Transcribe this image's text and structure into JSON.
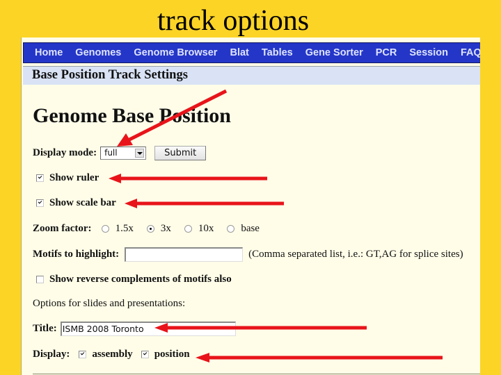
{
  "slide": {
    "title": "track options"
  },
  "navbar": {
    "items": [
      {
        "label": "Home"
      },
      {
        "label": "Genomes"
      },
      {
        "label": "Genome Browser"
      },
      {
        "label": "Blat"
      },
      {
        "label": "Tables"
      },
      {
        "label": "Gene Sorter"
      },
      {
        "label": "PCR"
      },
      {
        "label": "Session"
      },
      {
        "label": "FAQ"
      }
    ]
  },
  "settings_bar": {
    "title": "Base Position Track Settings"
  },
  "heading": "Genome Base Position",
  "display_mode": {
    "label": "Display mode:",
    "value": "full",
    "submit_label": "Submit"
  },
  "show_ruler": {
    "label": "Show ruler",
    "checked": true
  },
  "show_scale_bar": {
    "label": "Show scale bar",
    "checked": true
  },
  "zoom_factor": {
    "label": "Zoom factor:",
    "options": [
      {
        "label": "1.5x",
        "selected": false
      },
      {
        "label": "3x",
        "selected": true
      },
      {
        "label": "10x",
        "selected": false
      },
      {
        "label": "base",
        "selected": false
      }
    ]
  },
  "motifs": {
    "label": "Motifs to highlight:",
    "value": "",
    "hint": "(Comma separated list, i.e.: GT,AG for splice sites)"
  },
  "reverse_complements": {
    "label": "Show reverse complements of motifs also",
    "checked": false
  },
  "slides_section": {
    "label": "Options for slides and presentations:"
  },
  "title_field": {
    "label": "Title:",
    "value": "ISMB 2008 Toronto"
  },
  "display": {
    "label": "Display:",
    "assembly": {
      "label": "assembly",
      "checked": true
    },
    "position": {
      "label": "position",
      "checked": true
    }
  },
  "annotation": {
    "arrow_color": "#e8141a"
  }
}
